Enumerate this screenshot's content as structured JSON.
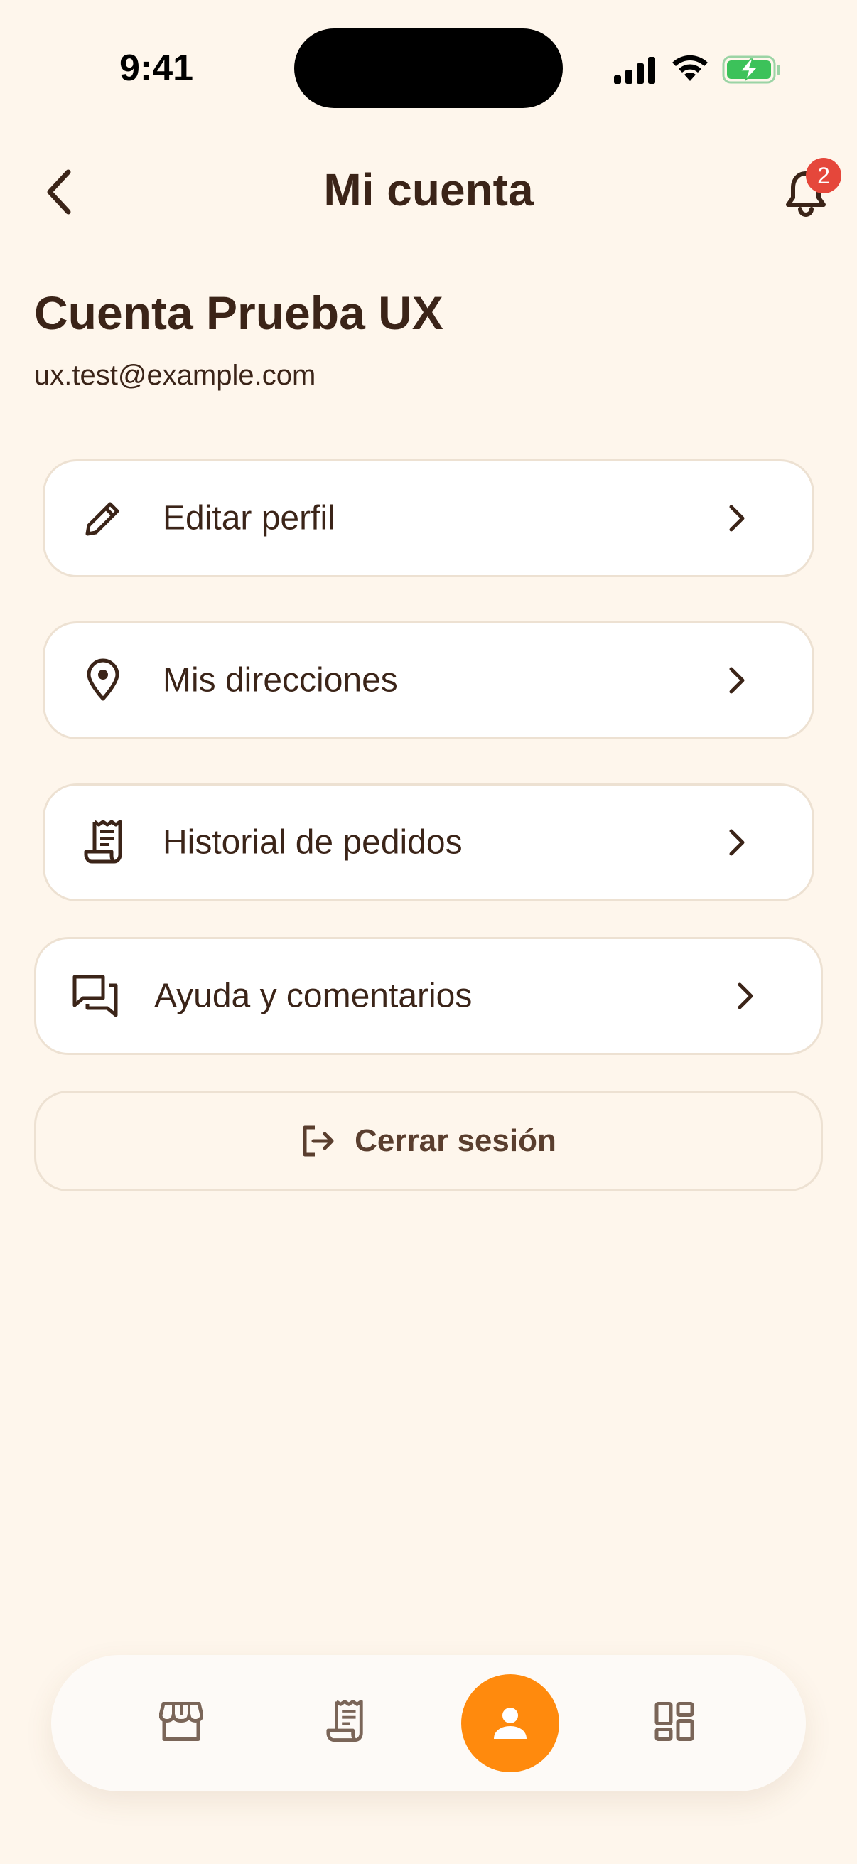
{
  "status_bar": {
    "time": "9:41"
  },
  "header": {
    "title": "Mi cuenta",
    "notification_count": "2"
  },
  "profile": {
    "name": "Cuenta Prueba UX",
    "email": "ux.test@example.com"
  },
  "menu": {
    "items": [
      {
        "label": "Editar perfil",
        "icon": "pencil-icon"
      },
      {
        "label": "Mis direcciones",
        "icon": "location-pin-icon"
      },
      {
        "label": "Historial de pedidos",
        "icon": "receipt-icon"
      },
      {
        "label": "Ayuda y comentarios",
        "icon": "chat-bubbles-icon"
      }
    ],
    "logout_label": "Cerrar sesión"
  },
  "bottom_nav": {
    "items": [
      {
        "icon": "store-icon",
        "active": false
      },
      {
        "icon": "receipt-icon",
        "active": false
      },
      {
        "icon": "person-icon",
        "active": true
      },
      {
        "icon": "dashboard-icon",
        "active": false
      }
    ]
  },
  "colors": {
    "background": "#FEF6EC",
    "text": "#3B2418",
    "accent": "#FF8A0D",
    "badge": "#E5473B",
    "card_border": "#EDE1D2"
  }
}
